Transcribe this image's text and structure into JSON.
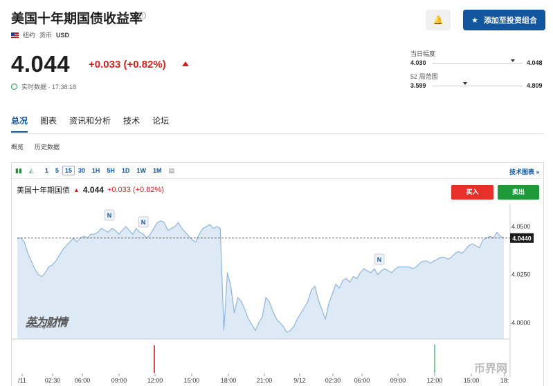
{
  "header": {
    "title": "美国十年期国债收益率",
    "exchange": "纽约",
    "currency_label": "货币",
    "currency": "USD",
    "price": "4.044",
    "change": "+0.033 (+0.82%)",
    "realtime": "实时数据 · 17:38:18",
    "watchlist_button": "添加至投资组合"
  },
  "ranges": {
    "day_label": "当日幅度",
    "day_low": "4.030",
    "day_high": "4.048",
    "day_marker": 0.89,
    "week52_label": "52 周范围",
    "week52_low": "3.599",
    "week52_high": "4.809",
    "week52_marker": 0.36
  },
  "tabs": [
    "总况",
    "图表",
    "资讯和分析",
    "技术",
    "论坛"
  ],
  "subtabs": [
    "概览",
    "历史数据"
  ],
  "toolbar": {
    "intervals": [
      "1",
      "5",
      "15",
      "30",
      "1H",
      "5H",
      "1D",
      "1W",
      "1M"
    ],
    "selected": "15",
    "tech_link": "技术图表 »"
  },
  "legend": {
    "name": "美国十年期国债",
    "price": "4.044",
    "change": "+0.033 (+0.82%)"
  },
  "buttons": {
    "buy": "买入",
    "sell": "卖出"
  },
  "watermark": {
    "brand": "英为财情",
    "sub": "Investing.com",
    "coin": "币界网"
  },
  "colors": {
    "up": "#d61f1f",
    "accent": "#1256a0",
    "area": "#dde9f4",
    "line": "#8fb6da"
  },
  "chart_data": {
    "type": "area",
    "y_ticks": [
      "4.0500",
      "4.0250",
      "4.0000"
    ],
    "ylim": [
      3.9915,
      4.0615
    ],
    "current_label": "4.0440",
    "current_value": 4.044,
    "x_ticks": [
      "/11",
      "02:30",
      "06:00",
      "09:00",
      "12:00",
      "15:00",
      "18:00",
      "21:00",
      "9/12",
      "02:30",
      "06:00",
      "09:00",
      "12:00",
      "15:00",
      "18:"
    ],
    "news_markers": [
      "N",
      "N",
      "N"
    ],
    "values": [
      4.044,
      4.044,
      4.042,
      4.036,
      4.032,
      4.028,
      4.025,
      4.024,
      4.026,
      4.029,
      4.03,
      4.032,
      4.035,
      4.038,
      4.04,
      4.042,
      4.044,
      4.042,
      4.044,
      4.045,
      4.044,
      4.046,
      4.046,
      4.047,
      4.049,
      4.048,
      4.047,
      4.049,
      4.048,
      4.046,
      4.048,
      4.05,
      4.048,
      4.046,
      4.049,
      4.047,
      4.046,
      4.044,
      4.046,
      4.049,
      4.052,
      4.053,
      4.052,
      4.048,
      4.049,
      4.05,
      4.052,
      4.049,
      4.047,
      4.045,
      4.043,
      4.042,
      4.046,
      4.049,
      4.05,
      4.051,
      4.049,
      4.05,
      4.049,
      3.996,
      4.026,
      4.019,
      4.005,
      4.013,
      4.011,
      4.007,
      4.002,
      3.999,
      3.996,
      4.0,
      4.003,
      4.013,
      4.011,
      4.006,
      4.002,
      4.0,
      3.998,
      3.995,
      3.996,
      3.998,
      4.002,
      4.005,
      4.008,
      4.011,
      4.017,
      4.019,
      4.012,
      4.007,
      4.002,
      4.01,
      4.015,
      4.02,
      4.018,
      4.022,
      4.023,
      4.021,
      4.024,
      4.023,
      4.026,
      4.028,
      4.027,
      4.026,
      4.028,
      4.025,
      4.027,
      4.028,
      4.027,
      4.026,
      4.028,
      4.029,
      4.029,
      4.029,
      4.029,
      4.028,
      4.029,
      4.031,
      4.032,
      4.032,
      4.031,
      4.032,
      4.033,
      4.034,
      4.034,
      4.033,
      4.034,
      4.036,
      4.037,
      4.036,
      4.038,
      4.04,
      4.041,
      4.04,
      4.039,
      4.043,
      4.044,
      4.045,
      4.044,
      4.047,
      4.045,
      4.044
    ],
    "grid": false
  }
}
